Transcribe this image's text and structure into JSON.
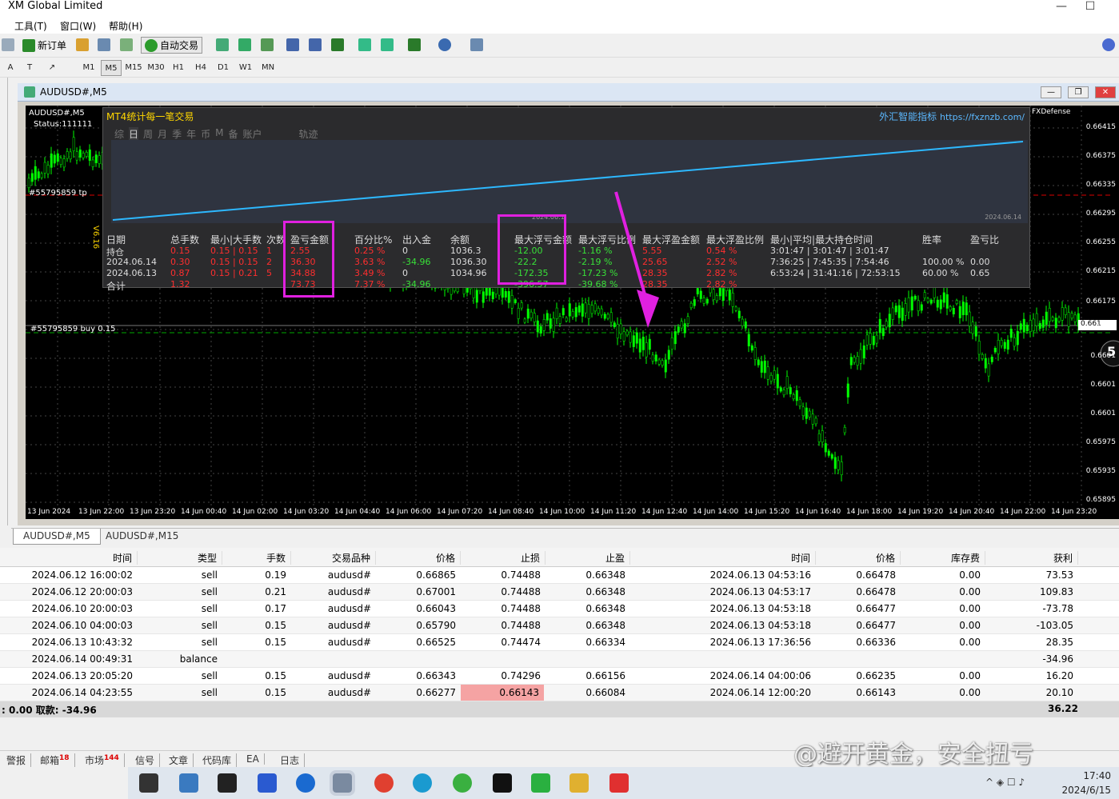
{
  "window": {
    "title": "XM Global Limited"
  },
  "menu": [
    "工具(T)",
    "窗口(W)",
    "帮助(H)"
  ],
  "toolbar": {
    "new_order": "新订单",
    "auto_trade": "自动交易"
  },
  "timeframes": [
    "M1",
    "M5",
    "M15",
    "M30",
    "H1",
    "H4",
    "D1",
    "W1",
    "MN"
  ],
  "timeframe_active": "M5",
  "chart_window": {
    "title": "AUDUSD#,M5"
  },
  "chart": {
    "symbol_label": "AUDUSD#,M5",
    "status": "Status:111111",
    "tp_line": "#55795859 tp",
    "buy_line": "#55795859 buy 0.15",
    "current_price": "0.661",
    "side_number": "5",
    "version": "V6.16",
    "price_labels": [
      "0.66415",
      "0.66375",
      "0.66335",
      "0.66295",
      "0.66255",
      "0.66215",
      "0.66175",
      "0.661",
      "0.6601",
      "0.6601",
      "0.6601",
      "0.65975",
      "0.65935",
      "0.65895"
    ],
    "time_labels": [
      "13 Jun 2024",
      "13 Jun 22:00",
      "13 Jun 23:20",
      "14 Jun 00:40",
      "14 Jun 02:00",
      "14 Jun 03:20",
      "14 Jun 04:40",
      "14 Jun 06:00",
      "14 Jun 07:20",
      "14 Jun 08:40",
      "14 Jun 10:00",
      "14 Jun 11:20",
      "14 Jun 12:40",
      "14 Jun 14:00",
      "14 Jun 15:20",
      "14 Jun 16:40",
      "14 Jun 18:00",
      "14 Jun 19:20",
      "14 Jun 20:40",
      "14 Jun 22:00",
      "14 Jun 23:20"
    ],
    "colors": {
      "candle": "#00ff00",
      "background": "#000000",
      "line": "#2db8ff",
      "magenta": "#e020e0"
    }
  },
  "overlay": {
    "title": "MT4统计每一笔交易",
    "brand": "外汇智能指标",
    "url": "https://fxznzb.com/",
    "defense": "FXDefense",
    "tabs": [
      "综",
      "日",
      "周",
      "月",
      "季",
      "年",
      "币",
      "M",
      "备",
      "账户",
      "轨迹"
    ],
    "active_tab": "日",
    "date_left": "2024.06.1",
    "date_right": "2024.06.14",
    "headers": [
      "日期",
      "总手数",
      "最小|大手数",
      "次数",
      "盈亏金额",
      "百分比%",
      "出入金",
      "余额",
      "最大浮亏金额",
      "最大浮亏比例",
      "最大浮盈金额",
      "最大浮盈比例",
      "最小|平均|最大持仓时间",
      "胜率",
      "盈亏比"
    ],
    "rows": [
      [
        "持仓",
        "0.15",
        "0.15 | 0.15",
        "1",
        "2.55",
        "0.25 %",
        "0",
        "1036.3",
        "-12.00",
        "-1.16 %",
        "5.55",
        "0.54 %",
        "3:01:47 | 3:01:47 | 3:01:47",
        "",
        ""
      ],
      [
        "2024.06.14",
        "0.30",
        "0.15 | 0.15",
        "2",
        "36.30",
        "3.63 %",
        "-34.96",
        "1036.30",
        "-22.2",
        "-2.19 %",
        "25.65",
        "2.52 %",
        "7:36:25 | 7:45:35 | 7:54:46",
        "100.00 %",
        "0.00"
      ],
      [
        "2024.06.13",
        "0.87",
        "0.15 | 0.21",
        "5",
        "34.88",
        "3.49 %",
        "0",
        "1034.96",
        "-172.35",
        "-17.23 %",
        "28.35",
        "2.82 %",
        "6:53:24 | 31:41:16 | 72:53:15",
        "60.00 %",
        "0.65"
      ],
      [
        "合计",
        "1.32",
        "",
        "",
        "73.73",
        "7.37 %",
        "-34.96",
        "",
        "-396.57",
        "-39.68 %",
        "28.35",
        "2.82 %",
        "",
        "",
        ""
      ]
    ],
    "line_series": [
      0.0,
      1.0
    ]
  },
  "chart_tabs": [
    "AUDUSD#,M5",
    "AUDUSD#,M15"
  ],
  "table": {
    "headers": [
      "时间",
      "类型",
      "手数",
      "交易品种",
      "价格",
      "止损",
      "止盈",
      "时间",
      "价格",
      "库存费",
      "获利"
    ],
    "rows": [
      [
        "2024.06.12 16:00:02",
        "sell",
        "0.19",
        "audusd#",
        "0.66865",
        "0.74488",
        "0.66348",
        "2024.06.13 04:53:16",
        "0.66478",
        "0.00",
        "73.53"
      ],
      [
        "2024.06.12 20:00:03",
        "sell",
        "0.21",
        "audusd#",
        "0.67001",
        "0.74488",
        "0.66348",
        "2024.06.13 04:53:17",
        "0.66478",
        "0.00",
        "109.83"
      ],
      [
        "2024.06.10 20:00:03",
        "sell",
        "0.17",
        "audusd#",
        "0.66043",
        "0.74488",
        "0.66348",
        "2024.06.13 04:53:18",
        "0.66477",
        "0.00",
        "-73.78"
      ],
      [
        "2024.06.10 04:00:03",
        "sell",
        "0.15",
        "audusd#",
        "0.65790",
        "0.74488",
        "0.66348",
        "2024.06.13 04:53:18",
        "0.66477",
        "0.00",
        "-103.05"
      ],
      [
        "2024.06.13 10:43:32",
        "sell",
        "0.15",
        "audusd#",
        "0.66525",
        "0.74474",
        "0.66334",
        "2024.06.13 17:36:56",
        "0.66336",
        "0.00",
        "28.35"
      ],
      [
        "2024.06.14 00:49:31",
        "balance",
        "",
        "",
        "",
        "",
        "",
        "",
        "",
        "",
        "-34.96"
      ],
      [
        "2024.06.13 20:05:20",
        "sell",
        "0.15",
        "audusd#",
        "0.66343",
        "0.74296",
        "0.66156",
        "2024.06.14 04:00:06",
        "0.66235",
        "0.00",
        "16.20"
      ],
      [
        "2024.06.14 04:23:55",
        "sell",
        "0.15",
        "audusd#",
        "0.66277",
        "0.66143",
        "0.66084",
        "2024.06.14 12:00:20",
        "0.66143",
        "0.00",
        "20.10"
      ]
    ],
    "total_left": ": 0.00  取款: -34.96",
    "total_profit": "36.22"
  },
  "bottom_tabs": [
    {
      "label": "警报",
      "badge": ""
    },
    {
      "label": "邮箱",
      "badge": "18"
    },
    {
      "label": "市场",
      "badge": "144"
    },
    {
      "label": "信号",
      "badge": ""
    },
    {
      "label": "文章",
      "badge": ""
    },
    {
      "label": "代码库",
      "badge": ""
    },
    {
      "label": "EA",
      "badge": ""
    },
    {
      "label": "日志",
      "badge": ""
    }
  ],
  "watermark": "@避开黄金，安全扭亏",
  "taskbar": {
    "time": "17:40",
    "date": "2024/6/15"
  }
}
